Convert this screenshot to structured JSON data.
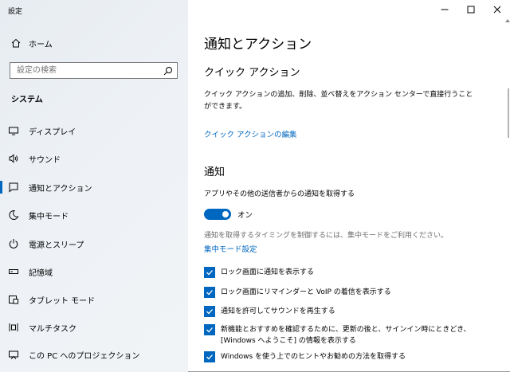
{
  "window": {
    "title": "設定"
  },
  "sidebar": {
    "home_label": "ホーム",
    "search_placeholder": "設定の検索",
    "section_title": "システム",
    "items": [
      {
        "label": "ディスプレイ",
        "icon": "display-icon"
      },
      {
        "label": "サウンド",
        "icon": "speaker-icon"
      },
      {
        "label": "通知とアクション",
        "icon": "notification-icon",
        "selected": true
      },
      {
        "label": "集中モード",
        "icon": "moon-icon"
      },
      {
        "label": "電源とスリープ",
        "icon": "power-icon"
      },
      {
        "label": "記憶域",
        "icon": "storage-icon"
      },
      {
        "label": "タブレット モード",
        "icon": "tablet-icon"
      },
      {
        "label": "マルチタスク",
        "icon": "multitask-icon"
      },
      {
        "label": "この PC へのプロジェクション",
        "icon": "projection-icon"
      }
    ]
  },
  "main": {
    "title": "通知とアクション",
    "quick_actions": {
      "heading": "クイック アクション",
      "description": "クイック アクションの追加、削除、並べ替えをアクション センターで直接行うことができます。",
      "edit_link": "クイック アクションの編集"
    },
    "notifications": {
      "heading": "通知",
      "get_notifications_label": "アプリやその他の送信者からの通知を取得する",
      "toggle_state": "オン",
      "toggle_on": true,
      "focus_description": "通知を取得するタイミングを制御するには、集中モードをご利用ください。",
      "focus_link": "集中モード設定",
      "checkboxes": [
        {
          "label": "ロック画面に通知を表示する",
          "checked": true
        },
        {
          "label": "ロック画面にリマインダーと VoIP の着信を表示する",
          "checked": true
        },
        {
          "label": "通知を許可してサウンドを再生する",
          "checked": true
        },
        {
          "label": "新機能とおすすめを確認するために、更新の後と、サインイン時にときどき、[Windows へようこそ] の情報を表示する",
          "checked": true
        },
        {
          "label": "Windows を使う上でのヒントやお勧めの方法を取得する",
          "checked": true
        }
      ]
    }
  },
  "colors": {
    "accent": "#0067c0",
    "sidebar_bg": "#eceff3",
    "text": "#000000",
    "muted": "#6d6d6d"
  }
}
